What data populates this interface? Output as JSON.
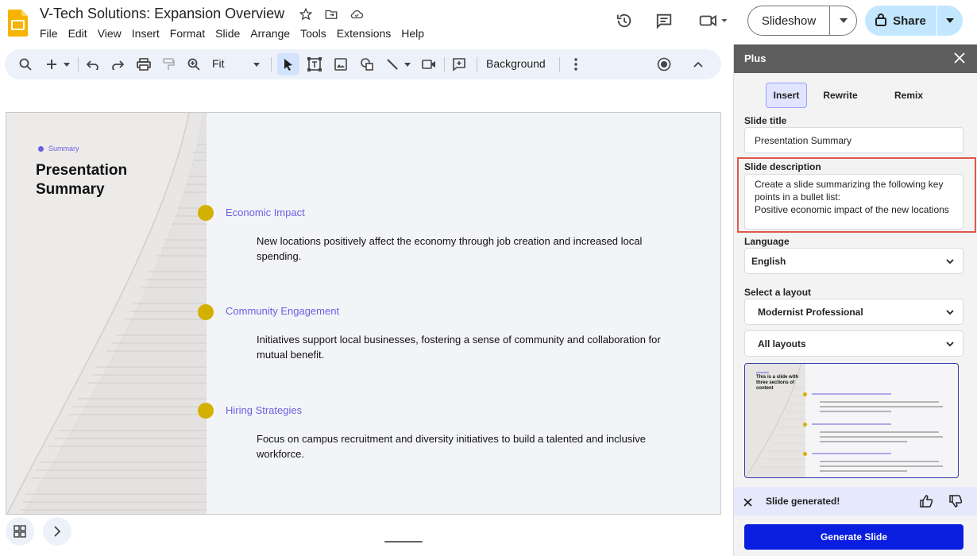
{
  "header": {
    "doc_title": "V-Tech Solutions: Expansion Overview",
    "menu": [
      "File",
      "Edit",
      "View",
      "Insert",
      "Format",
      "Slide",
      "Arrange",
      "Tools",
      "Extensions",
      "Help"
    ],
    "slideshow_label": "Slideshow",
    "share_label": "Share"
  },
  "toolbar": {
    "zoom_label": "Fit",
    "background_label": "Background"
  },
  "slide": {
    "tag": "Summary",
    "title": "Presentation Summary",
    "sections": [
      {
        "heading": "Economic Impact",
        "body": "New locations positively affect the economy through job creation and increased local spending."
      },
      {
        "heading": "Community Engagement",
        "body": "Initiatives support local businesses, fostering a sense of community and collaboration for mutual benefit."
      },
      {
        "heading": "Hiring Strategies",
        "body": "Focus on campus recruitment and diversity initiatives to build a talented and inclusive workforce."
      }
    ]
  },
  "panel": {
    "title": "Plus",
    "tabs": [
      "Insert",
      "Rewrite",
      "Remix"
    ],
    "selected_tab": "Insert",
    "slide_title_label": "Slide title",
    "slide_title_value": "Presentation Summary",
    "slide_description_label": "Slide description",
    "slide_description_value": "Create a slide summarizing the following key points in a bullet list:\nPositive economic impact of the new locations",
    "language_label": "Language",
    "language_value": "English",
    "layout_label": "Select a layout",
    "layout_value": "Modernist Professional",
    "layout_filter_value": "All layouts",
    "preview_title": "This is a slide with three sections of content",
    "status_text": "Slide generated!",
    "generate_label": "Generate Slide"
  },
  "colors": {
    "accent_purple": "#6a5fe0",
    "bullet_gold": "#d4b000",
    "generate_blue": "#0a1ee0",
    "highlight_red": "#e0584a",
    "share_blue": "#c2e7ff"
  }
}
